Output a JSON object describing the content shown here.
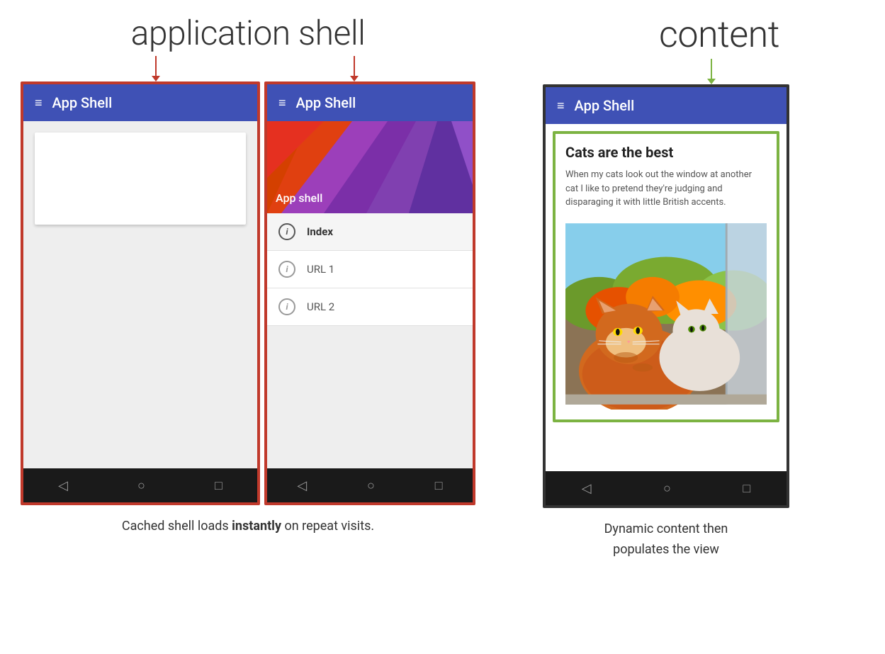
{
  "page": {
    "background": "#ffffff"
  },
  "left_label": {
    "text": "application shell"
  },
  "right_label": {
    "text": "content"
  },
  "phone1": {
    "app_bar_title": "App Shell",
    "app_bar_icon": "≡"
  },
  "phone2": {
    "app_bar_title": "App Shell",
    "app_bar_icon": "≡",
    "drawer_header_text": "App shell",
    "drawer_items": [
      {
        "label": "Index",
        "active": true
      },
      {
        "label": "URL 1",
        "active": false
      },
      {
        "label": "URL 2",
        "active": false
      }
    ]
  },
  "phone3": {
    "app_bar_title": "App Shell",
    "app_bar_icon": "≡",
    "article_title": "Cats are the best",
    "article_body": "When my cats look out the window at another cat I like to pretend they're judging and disparaging it with little British accents."
  },
  "nav_icons": {
    "back": "◁",
    "home": "○",
    "recent": "□"
  },
  "caption_left": {
    "text_plain": "Cached shell loads ",
    "text_bold": "instantly",
    "text_end": " on repeat visits."
  },
  "caption_right": {
    "line1": "Dynamic content then",
    "line2": "populates the view"
  }
}
